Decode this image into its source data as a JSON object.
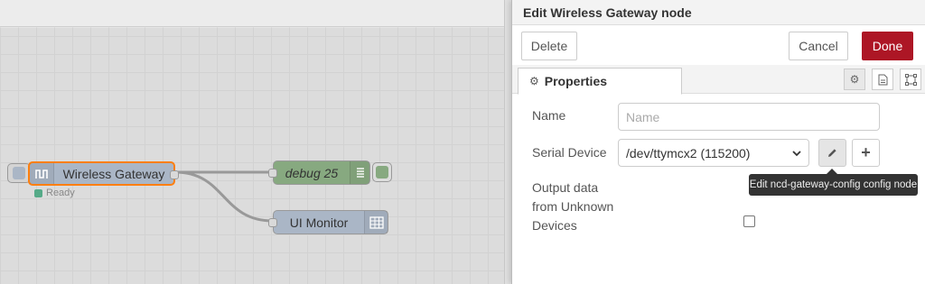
{
  "workspace": {
    "nodes": {
      "gateway": {
        "label": "Wireless Gateway",
        "status": "Ready"
      },
      "debug": {
        "label": "debug 25"
      },
      "ui_monitor": {
        "label": "UI Monitor"
      }
    }
  },
  "tray": {
    "title": "Edit Wireless Gateway node",
    "buttons": {
      "delete": "Delete",
      "cancel": "Cancel",
      "done": "Done"
    },
    "tabs": {
      "properties": "Properties"
    },
    "form": {
      "name_label": "Name",
      "name_placeholder": "Name",
      "name_value": "",
      "serial_label": "Serial Device",
      "serial_value": "/dev/ttymcx2 (115200)",
      "edit_tooltip": "Edit ncd-gateway-config config node",
      "unknown_label": "Output data from Unknown Devices",
      "unknown_checked": false
    }
  },
  "colors": {
    "done": "#ad1625",
    "gateway_node": "#aab6c6",
    "debug_node": "#87a980",
    "selected": "#ff7f0e"
  }
}
